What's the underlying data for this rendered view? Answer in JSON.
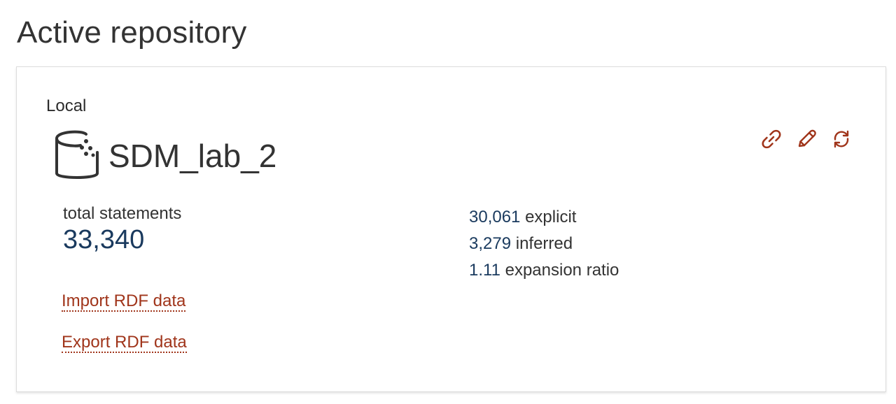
{
  "page": {
    "title": "Active repository"
  },
  "repository": {
    "location": "Local",
    "name": "SDM_lab_2",
    "icon": "database-icon",
    "total_label": "total statements",
    "total_value": "33,340",
    "stats": [
      {
        "value": "30,061",
        "label": "explicit"
      },
      {
        "value": "3,279",
        "label": "inferred"
      },
      {
        "value": "1.11",
        "label": "expansion ratio"
      }
    ],
    "links": {
      "import": "Import RDF data",
      "export": "Export RDF data"
    },
    "actions": [
      {
        "name": "link-icon",
        "title": "Copy repository URL"
      },
      {
        "name": "edit-icon",
        "title": "Edit repository"
      },
      {
        "name": "refresh-icon",
        "title": "Restart repository"
      }
    ]
  },
  "colors": {
    "accent": "#a0351b",
    "number": "#1a3a5e",
    "text": "#333333"
  }
}
